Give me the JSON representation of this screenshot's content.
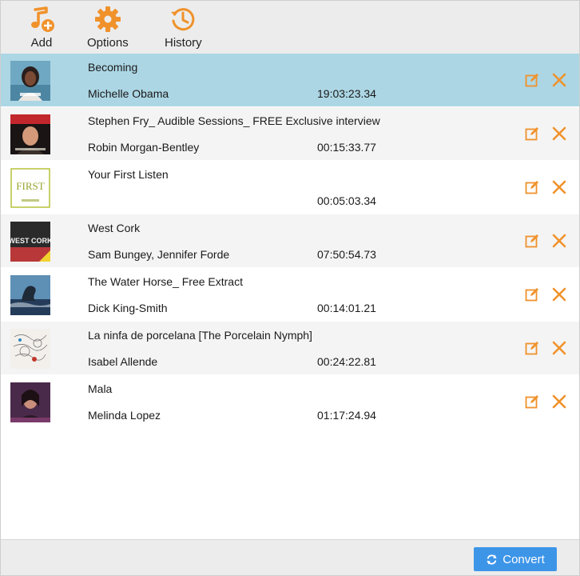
{
  "toolbar": {
    "add_label": "Add",
    "options_label": "Options",
    "history_label": "History",
    "accent_color": "#f0922b"
  },
  "list": {
    "selected_color": "#acd6e4",
    "items": [
      {
        "title": "Becoming",
        "author": "Michelle Obama",
        "duration": "19:03:23.34",
        "cover": "becoming-cover"
      },
      {
        "title": "Stephen Fry_ Audible Sessions_ FREE Exclusive interview",
        "author": "Robin Morgan-Bentley",
        "duration": "00:15:33.77",
        "cover": "stephen-fry-cover"
      },
      {
        "title": "Your First Listen",
        "author": "",
        "duration": "00:05:03.34",
        "cover": "your-first-listen-cover",
        "cover_text": "FIRST"
      },
      {
        "title": "West Cork",
        "author": "Sam Bungey, Jennifer Forde",
        "duration": "07:50:54.73",
        "cover": "west-cork-cover",
        "cover_text": "WEST CORK"
      },
      {
        "title": "The Water Horse_ Free Extract",
        "author": "Dick King-Smith",
        "duration": "00:14:01.21",
        "cover": "water-horse-cover"
      },
      {
        "title": "La ninfa de porcelana [The Porcelain Nymph]",
        "author": "Isabel Allende",
        "duration": "00:24:22.81",
        "cover": "porcelain-nymph-cover"
      },
      {
        "title": "Mala",
        "author": "Melinda Lopez",
        "duration": "01:17:24.94",
        "cover": "mala-cover"
      }
    ]
  },
  "footer": {
    "convert_label": "Convert",
    "convert_color": "#3d95e8"
  }
}
